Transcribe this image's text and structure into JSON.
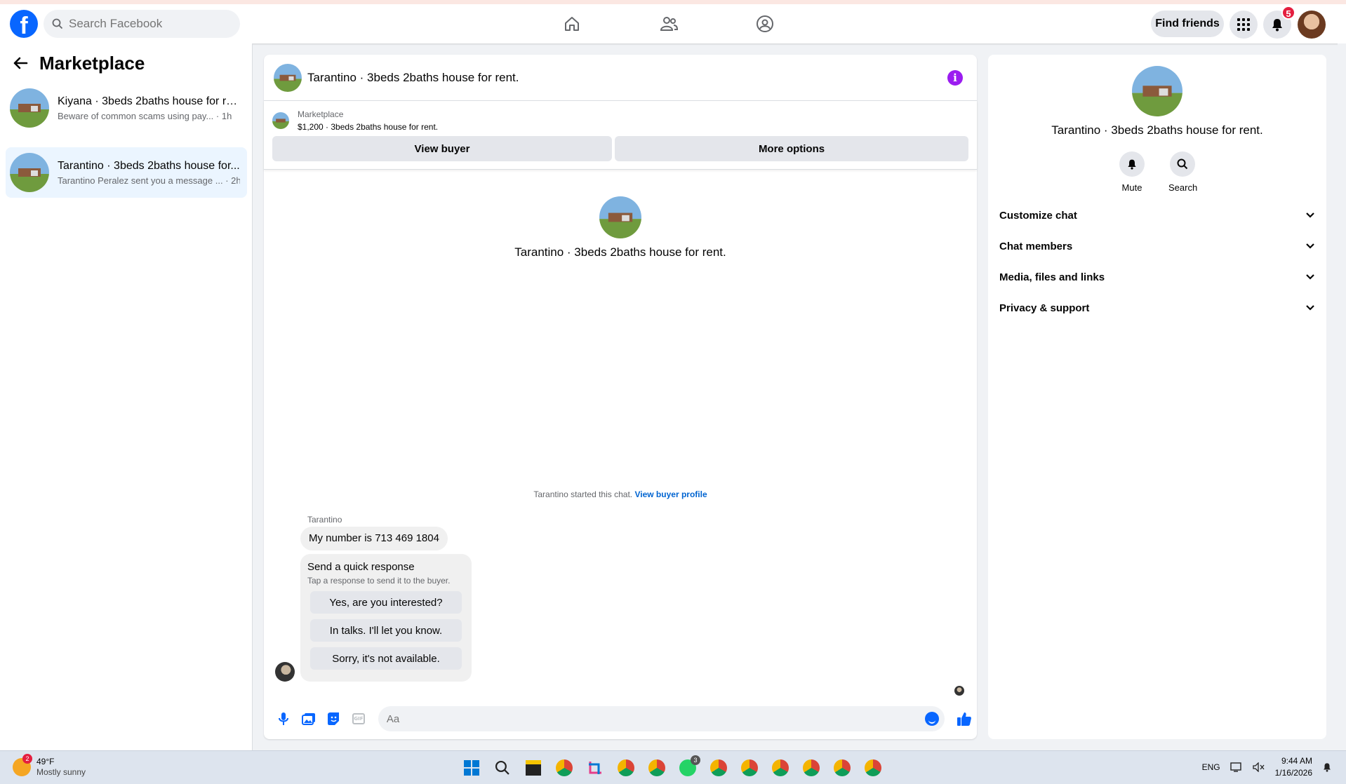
{
  "header": {
    "logo": "f",
    "search_placeholder": "Search Facebook",
    "nav_icons": [
      "home-icon",
      "friends-icon",
      "groups-icon"
    ],
    "find_friends": "Find friends",
    "notification_count": "5"
  },
  "sidebar": {
    "title": "Marketplace",
    "conversations": [
      {
        "title": "Kiyana · 3beds 2baths house for re...",
        "preview": "Beware of common scams using pay...",
        "time": "· 1h",
        "active": false
      },
      {
        "title": "Tarantino · 3beds 2baths house for...",
        "preview": "Tarantino Peralez sent you a message ...",
        "time": "· 2h",
        "active": true
      }
    ]
  },
  "chat": {
    "title": "Tarantino · 3beds 2baths house for rent.",
    "listing_source": "Marketplace",
    "listing_price": "$1,200 · 3beds 2baths house for rent.",
    "view_buyer": "View buyer",
    "more_options": "More options",
    "hero_title": "Tarantino · 3beds 2baths house for rent.",
    "started_text": "Tarantino started this chat.",
    "view_buyer_profile": "View buyer profile",
    "sender": "Tarantino",
    "message": "My number is 713 469 1804",
    "quick_title": "Send a quick response",
    "quick_subtitle": "Tap a response to send it to the buyer.",
    "quick_responses": [
      "Yes, are you interested?",
      "In talks. I'll let you know.",
      "Sorry, it's not available."
    ],
    "composer_placeholder": "Aa",
    "gif_label": "GIF"
  },
  "details": {
    "title": "Tarantino · 3beds 2baths house for rent.",
    "actions": [
      {
        "label": "Mute"
      },
      {
        "label": "Search"
      }
    ],
    "sections": [
      "Customize chat",
      "Chat members",
      "Media, files and links",
      "Privacy & support"
    ]
  },
  "taskbar": {
    "weather_badge": "2",
    "temperature": "49°F",
    "condition": "Mostly sunny",
    "whatsapp_badge": "3",
    "language": "ENG",
    "time": "9:44 AM",
    "date": "1/16/2026"
  },
  "colors": {
    "brand": "#0866ff",
    "info": "#9b1cf0",
    "badge": "#e41e3f"
  }
}
